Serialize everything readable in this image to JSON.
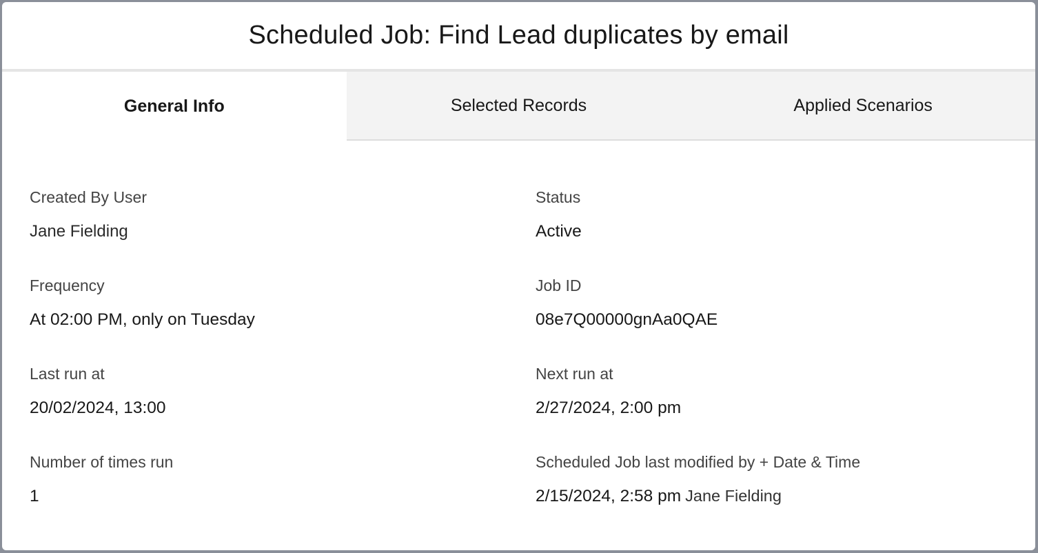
{
  "modal": {
    "title": "Scheduled Job: Find Lead duplicates by email"
  },
  "tabs": [
    {
      "label": "General Info",
      "active": true
    },
    {
      "label": "Selected Records",
      "active": false
    },
    {
      "label": "Applied Scenarios",
      "active": false
    }
  ],
  "fields": {
    "created_by": {
      "label": "Created By User",
      "value": "Jane Fielding"
    },
    "status": {
      "label": "Status",
      "value": "Active"
    },
    "frequency": {
      "label": "Frequency",
      "value": "At 02:00 PM, only on Tuesday"
    },
    "job_id": {
      "label": "Job ID",
      "value": "08e7Q00000gnAa0QAE"
    },
    "last_run": {
      "label": "Last run at",
      "value": "20/02/2024, 13:00"
    },
    "next_run": {
      "label": "Next run at",
      "value": "2/27/2024, 2:00 pm"
    },
    "times_run": {
      "label": "Number of times run",
      "value": "1"
    },
    "last_modified": {
      "label": "Scheduled Job last modified by + Date & Time",
      "date": "2/15/2024, 2:58 pm",
      "user": "Jane Fielding"
    }
  },
  "colors": {
    "title_text": "#181818",
    "inactive_tab_bg": "#f3f3f3",
    "active_tab_bg": "#ffffff",
    "label_text": "#444444"
  }
}
